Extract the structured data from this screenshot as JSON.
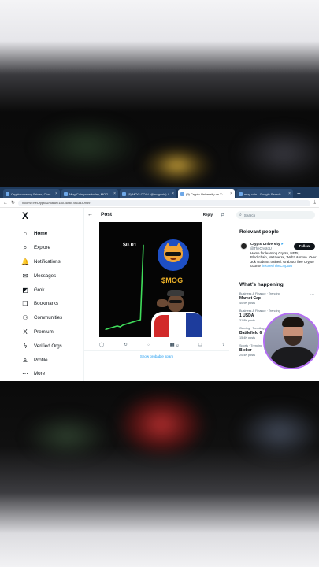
{
  "browser": {
    "tabs": [
      {
        "title": "Cryptocurrency Prices, Char",
        "active": false
      },
      {
        "title": "Mog Coin price today, MOG",
        "active": false
      },
      {
        "title": "(8) MOG COIN (@mogcoin) /",
        "active": false
      },
      {
        "title": "(9) Crypto University on X:",
        "active": true
      },
      {
        "title": "mog coin - Google Search",
        "active": false
      }
    ],
    "url": "x.com/TheCryptoU/status/1807588478638309597"
  },
  "sidebar": {
    "logo": "X",
    "items": [
      {
        "label": "Home",
        "icon": "home-icon",
        "glyph": "⌂"
      },
      {
        "label": "Explore",
        "icon": "search-icon",
        "glyph": "⌕"
      },
      {
        "label": "Notifications",
        "icon": "bell-icon",
        "glyph": "🔔"
      },
      {
        "label": "Messages",
        "icon": "mail-icon",
        "glyph": "✉"
      },
      {
        "label": "Grok",
        "icon": "grok-icon",
        "glyph": "◩"
      },
      {
        "label": "Bookmarks",
        "icon": "bookmark-icon",
        "glyph": "❑"
      },
      {
        "label": "Communities",
        "icon": "people-icon",
        "glyph": "⚇"
      },
      {
        "label": "Premium",
        "icon": "x-logo-icon",
        "glyph": "X"
      },
      {
        "label": "Verified Orgs",
        "icon": "lightning-icon",
        "glyph": "ϟ"
      },
      {
        "label": "Profile",
        "icon": "person-icon",
        "glyph": "♙"
      },
      {
        "label": "More",
        "icon": "more-circle-icon",
        "glyph": "⋯"
      }
    ]
  },
  "post": {
    "title": "Post",
    "reply_label": "Reply",
    "media": {
      "price_label": "$0.01",
      "token_label": "$MOG"
    },
    "actions": {
      "views": "32"
    },
    "show_spam": "Show probable spam"
  },
  "right": {
    "search_placeholder": "Search",
    "relevant_title": "Relevant people",
    "person": {
      "name": "Crypto University",
      "handle": "@TheCryptoU",
      "follow_label": "Follow",
      "bio": "Home for learning Crypto, NFTs, Blockchain, Metaverse, Web3 & more. Over 30k students trained. Grab our free Crypto course",
      "bio_link": "linktr.ee/TheCryptoU"
    },
    "happening_title": "What’s happening",
    "trends": [
      {
        "context": "Business & Finance · Trending",
        "name": "Market Cap",
        "count": "40.9K posts"
      },
      {
        "context": "Business & Finance · Trending",
        "name": "1 USDA",
        "count": "31.8K posts"
      },
      {
        "context": "Gaming · Trending",
        "name": "Battlefield 6",
        "count": "15.4K posts"
      },
      {
        "context": "Sports · Trending",
        "name": "Bieber",
        "count": "20.4K posts"
      }
    ]
  },
  "chart_data": {
    "type": "line",
    "title": "",
    "xlabel": "",
    "ylabel": "",
    "x": [
      0,
      1,
      2,
      3,
      4,
      5,
      6,
      7,
      8,
      9,
      10,
      11,
      12,
      13
    ],
    "series": [
      {
        "values": [
          0.0005,
          0.0006,
          0.0007,
          0.0008,
          0.0009,
          0.0008,
          0.001,
          0.0011,
          0.0012,
          0.0013,
          0.0014,
          0.0015,
          0.0016,
          0.01
        ]
      }
    ],
    "ylim": [
      0,
      0.011
    ],
    "grid": false
  }
}
